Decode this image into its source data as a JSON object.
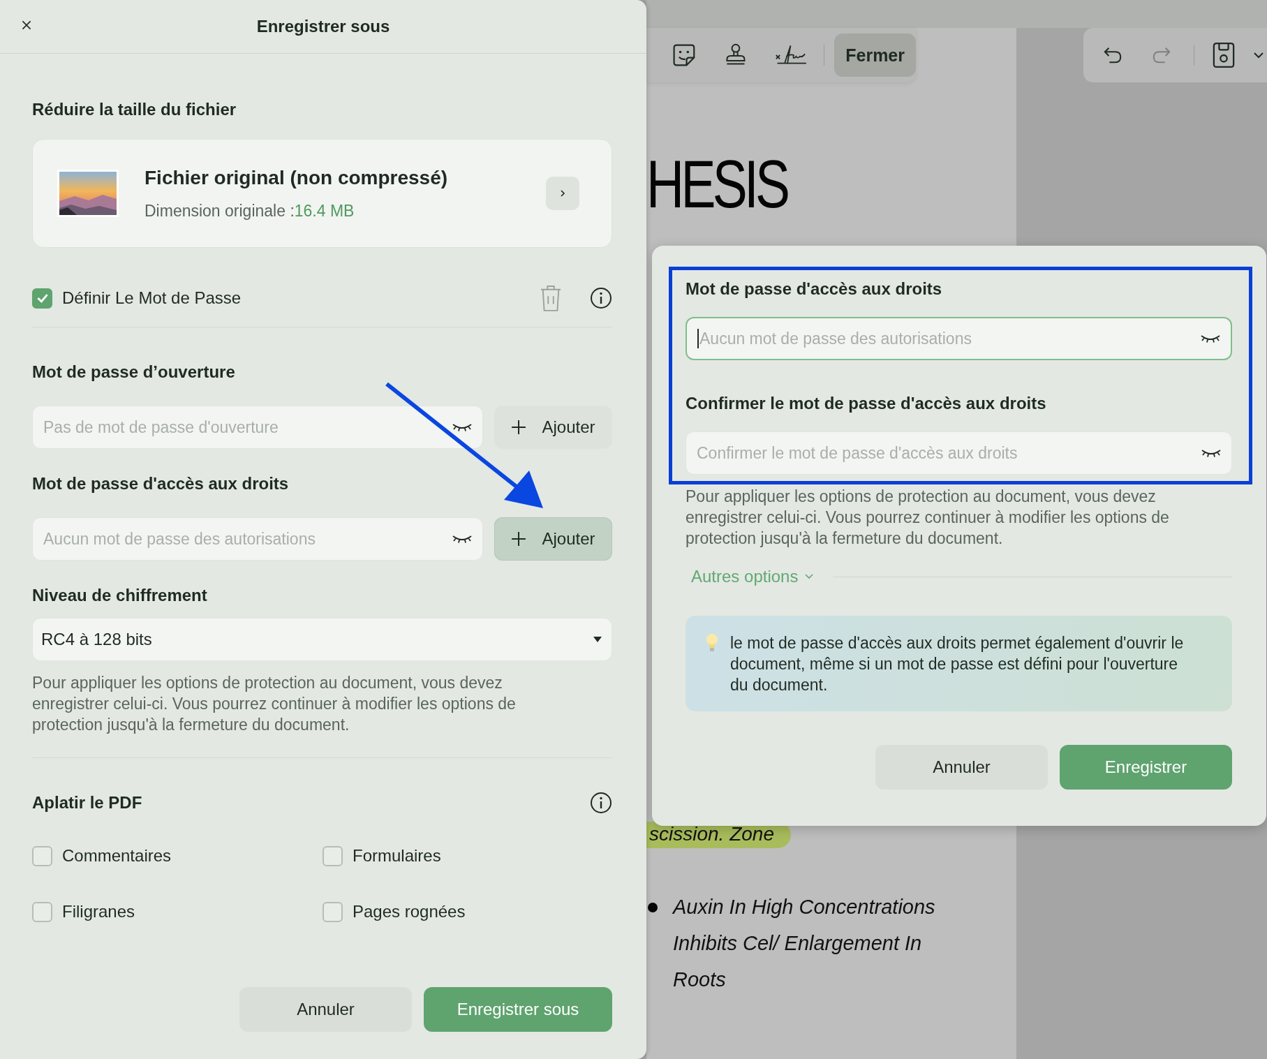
{
  "save_as_panel": {
    "title": "Enregistrer sous",
    "compress": {
      "heading": "Réduire la taille du fichier",
      "option_title": "Fichier original (non compressé)",
      "size_label": "Dimension originale :",
      "size_value": "16.4 MB"
    },
    "set_password": {
      "label": "Définir Le Mot de Passe",
      "checked": true
    },
    "password_fields": [
      {
        "heading": "Mot de passe d’ouverture",
        "placeholder": "Pas de mot de passe d'ouverture",
        "button": "Ajouter",
        "highlighted": false
      },
      {
        "heading": "Mot de passe d'accès aux droits",
        "placeholder": "Aucun mot de passe des autorisations",
        "button": "Ajouter",
        "highlighted": true
      }
    ],
    "encryption": {
      "heading": "Niveau de chiffrement",
      "value": "RC4 à 128 bits"
    },
    "note": "Pour appliquer les options de protection au document, vous devez enregistrer celui-ci. Vous pourrez continuer à modifier les options de protection jusqu'à la fermeture du document.",
    "flatten": {
      "heading": "Aplatir le PDF",
      "options": [
        {
          "label": "Commentaires",
          "checked": false
        },
        {
          "label": "Formulaires",
          "checked": false
        },
        {
          "label": "Filigranes",
          "checked": false
        },
        {
          "label": "Pages rognées",
          "checked": false
        }
      ]
    },
    "buttons": [
      {
        "label": "Annuler",
        "kind": "secondary"
      },
      {
        "label": "Enregistrer sous",
        "kind": "primary"
      }
    ]
  },
  "toolbar": {
    "close_button": "Fermer",
    "history": [
      {
        "kind": "undo",
        "disabled": false
      },
      {
        "kind": "redo",
        "disabled": true
      }
    ]
  },
  "document": {
    "heading": "HESIS",
    "highlight": "scission. Zone",
    "bullet_lines": [
      "Auxin In High Concentrations",
      "Inhibits Cel/ Enlargement In",
      "Roots"
    ]
  },
  "permissions_dialog": {
    "fields": [
      {
        "label": "Mot de passe d'accès aux droits",
        "placeholder": "Aucun mot de passe des autorisations",
        "focused": true
      },
      {
        "label": "Confirmer le mot de passe d'accès aux droits",
        "placeholder": "Confirmer le mot de passe d'accès aux droits",
        "focused": false
      }
    ],
    "note": "Pour appliquer les options de protection au document, vous devez enregistrer celui-ci. Vous pourrez continuer à modifier les options de protection jusqu'à la fermeture du document.",
    "more_options": "Autres options",
    "tip": "le mot de passe d'accès aux droits permet également d'ouvrir le document, même si un mot de passe est défini pour l'ouverture du document.",
    "buttons": [
      {
        "label": "Annuler",
        "kind": "secondary"
      },
      {
        "label": "Enregistrer",
        "kind": "primary"
      }
    ]
  }
}
